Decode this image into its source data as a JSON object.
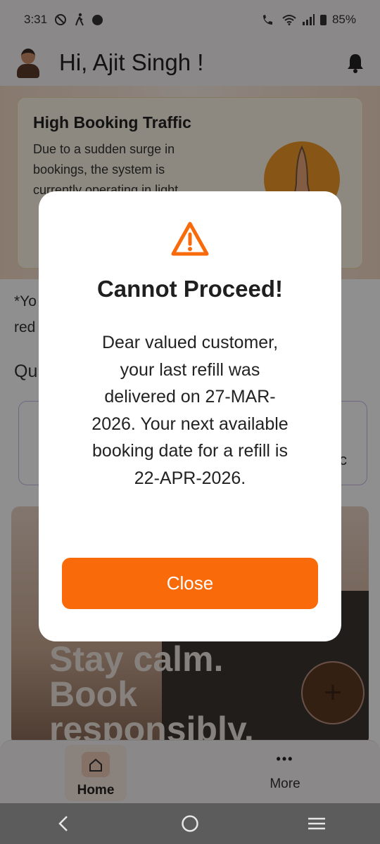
{
  "status_bar": {
    "time": "3:31",
    "battery": "85%"
  },
  "header": {
    "greeting": "Hi, Ajit Singh !"
  },
  "traffic_card": {
    "title": "High Booking Traffic",
    "body": "Due to a sudden surge in bookings, the system is currently operating in light"
  },
  "background_text": {
    "note": "*Yo",
    "note2": "red",
    "section": "Qu",
    "quick_card_text": "c"
  },
  "promo": {
    "text": "Stay calm. Book responsibly."
  },
  "fab": {
    "label": "+"
  },
  "bottom_nav": {
    "home_label": "Home",
    "more_label": "More",
    "more_icon": "•••"
  },
  "dialog": {
    "title": "Cannot Proceed!",
    "message": "Dear valued customer, your last refill was delivered on 27-MAR-2026. Your next available booking date for a refill is 22-APR-2026.",
    "close_label": "Close"
  },
  "colors": {
    "accent": "#F96A0A",
    "warning_icon": "#F96A0A"
  },
  "icons": [
    "avatar",
    "bell-icon",
    "warning-icon",
    "home-icon",
    "more-icon",
    "back-icon",
    "home-circle-icon",
    "recents-icon"
  ]
}
